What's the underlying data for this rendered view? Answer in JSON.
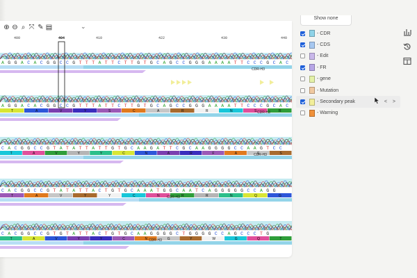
{
  "toolbar": {
    "icons": [
      "zoom-in-icon",
      "zoom-out-icon",
      "zoom-reset-icon",
      "fit-icon",
      "pencil-icon",
      "document-icon"
    ]
  },
  "ruler": {
    "ticks": [
      "400",
      "404",
      "410",
      "422",
      "430",
      "440"
    ],
    "selected_tick": "404"
  },
  "tracks": [
    {
      "bases": "AGGACACGGCCGTTTATTCTTGTGCAGCCGGGAAAATTCCCGCAC",
      "region_label": "CDR-H3"
    },
    {
      "bases": "AGGACACGGCCGTTTATTCTTGTGCAGCCGGGAAAATTCCCGCAC",
      "region_label": "CDR-H3",
      "aa": [
        "T",
        "A",
        "V",
        "Y",
        "S",
        "C",
        "A",
        "R",
        "R",
        "N",
        "S",
        "R"
      ]
    },
    {
      "bases": "CACGGCCGTATATTATTGTGCAAGATTCGCAAGGGGCCAAGTCC",
      "region_label": "CDR-H3",
      "aa": [
        "T",
        "A",
        "V",
        "Y",
        "Y",
        "C",
        "N",
        "A",
        "R",
        "F",
        "A",
        "S",
        "S"
      ]
    },
    {
      "bases": "CACGGCCGTATATTACTGTGCAAATGGCAATCAGGGGGCCAGG",
      "region_label": "CDR-H3",
      "aa": [
        "T",
        "A",
        "V",
        "Y",
        "Y",
        "C",
        "N",
        "R",
        "R",
        "N",
        "Q",
        "G"
      ]
    },
    {
      "bases": "CACGGCCGTGTATTACTGTGCAAGGGGCTGGGGCCAGCCCTG",
      "region_label": "CDR-H3",
      "aa": [
        "T",
        "A",
        "V",
        "Y",
        "Y",
        "C",
        "N",
        "G",
        "Y",
        "W",
        "G",
        "Q",
        "T"
      ]
    }
  ],
  "legend": {
    "header": "Show none",
    "items": [
      {
        "label": "CDR",
        "checked": true,
        "color": "#8fd3e8"
      },
      {
        "label": "CDS",
        "checked": true,
        "color": "#a7c8f0"
      },
      {
        "label": "Edit",
        "checked": false,
        "color": "#c9b8ea"
      },
      {
        "label": "FR",
        "checked": true,
        "color": "#b7a6e6"
      },
      {
        "label": "gene",
        "checked": false,
        "color": "#e5f2a8"
      },
      {
        "label": "Mutation",
        "checked": false,
        "color": "#f0c9a0"
      },
      {
        "label": "Secondary peak",
        "checked": true,
        "color": "#f2ee9a",
        "hover": true
      },
      {
        "label": "Warning",
        "checked": false,
        "color": "#f0913a"
      }
    ],
    "nav_prev": "<",
    "nav_next": ">"
  },
  "side_icons": [
    "bar-chart-icon",
    "history-icon",
    "columns-icon"
  ],
  "colors": {
    "A": "#2ca02c",
    "C": "#1f4fd6",
    "G": "#222222",
    "T": "#d62728",
    "cdr": "#8fd3e8",
    "fr": "#d6b8f0",
    "cds": "#b8def5",
    "trace_bg": "#bfe9f0"
  }
}
